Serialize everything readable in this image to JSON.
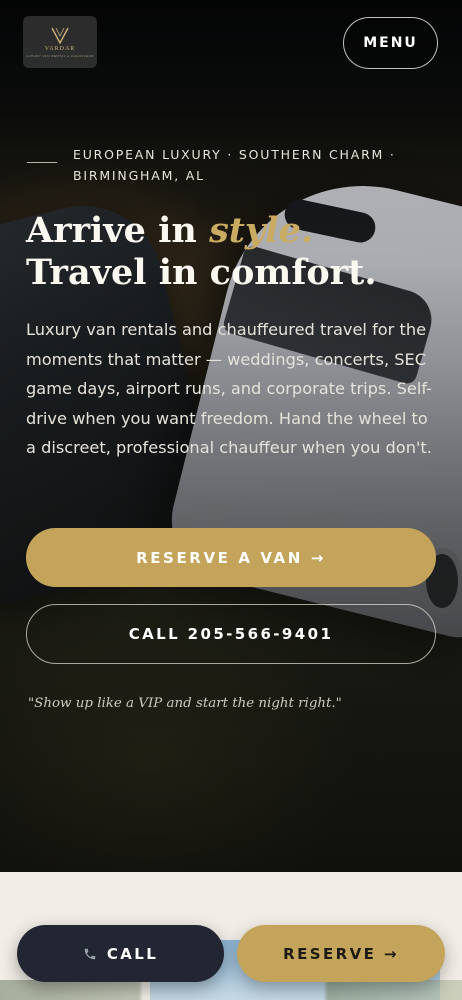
{
  "brand": {
    "name": "VARDAR",
    "tagline": "LUXURY VAN RENTAL & CHAUFFEUR",
    "accent_color": "#c3a45a",
    "dark_color": "#222633"
  },
  "header": {
    "menu_label": "MENU"
  },
  "hero": {
    "eyebrow": "EUROPEAN LUXURY · SOUTHERN CHARM · BIRMINGHAM, AL",
    "headline_part1": "Arrive in ",
    "headline_accent": "style.",
    "headline_line2": "Travel in comfort.",
    "description": "Luxury van rentals and chauffeured travel for the moments that matter — weddings, concerts, SEC game days, airport runs, and corporate trips. Self-drive when you want freedom. Hand the wheel to a discreet, professional chauffeur when you don't.",
    "primary_cta": "RESERVE A VAN →",
    "secondary_cta": "CALL 205-566-9401",
    "quote": "\"Show up like a VIP and start the night right.\""
  },
  "sticky_bar": {
    "call_label": "CALL",
    "call_icon": "phone-icon",
    "reserve_label": "RESERVE →"
  }
}
